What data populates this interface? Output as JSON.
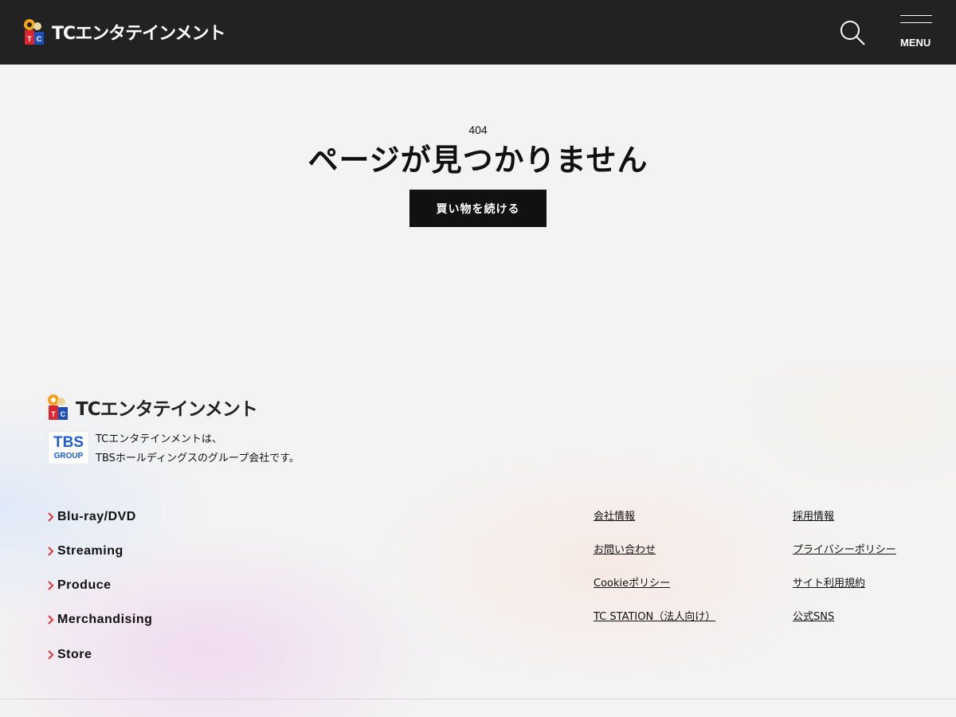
{
  "header": {
    "logo_text": "TCエンタテインメント",
    "logo_mark_letters": "TC",
    "search_icon": "search-icon",
    "menu_icon": "hamburger-menu-icon",
    "menu_label": "MENU",
    "background_color": "#222222"
  },
  "main": {
    "error_code": "404",
    "error_title": "ページが見つかりません",
    "continue_button_label": "買い物を続ける"
  },
  "footer": {
    "logo_text": "TCエンタテインメント",
    "tbs_badge": {
      "line1": "TBS",
      "line2": "GROUP",
      "color": "#1f5cd4"
    },
    "tbs_text_line1": "TCエンタテインメントは、",
    "tbs_text_line2": "TBSホールディングスのグループ会社です。",
    "nav_items": [
      {
        "label": "Blu-ray/DVD"
      },
      {
        "label": "Streaming"
      },
      {
        "label": "Produce"
      },
      {
        "label": "Merchandising"
      },
      {
        "label": "Store"
      }
    ],
    "chevron_color": "#e0333a",
    "links_col1": [
      {
        "label": "会社情報"
      },
      {
        "label": "お問い合わせ"
      },
      {
        "label": "Cookieポリシー"
      },
      {
        "label": "TC STATION（法人向け）"
      }
    ],
    "links_col2": [
      {
        "label": "採用情報"
      },
      {
        "label": "プライバシーポリシー"
      },
      {
        "label": "サイト利用規約"
      },
      {
        "label": "公式SNS"
      }
    ]
  }
}
